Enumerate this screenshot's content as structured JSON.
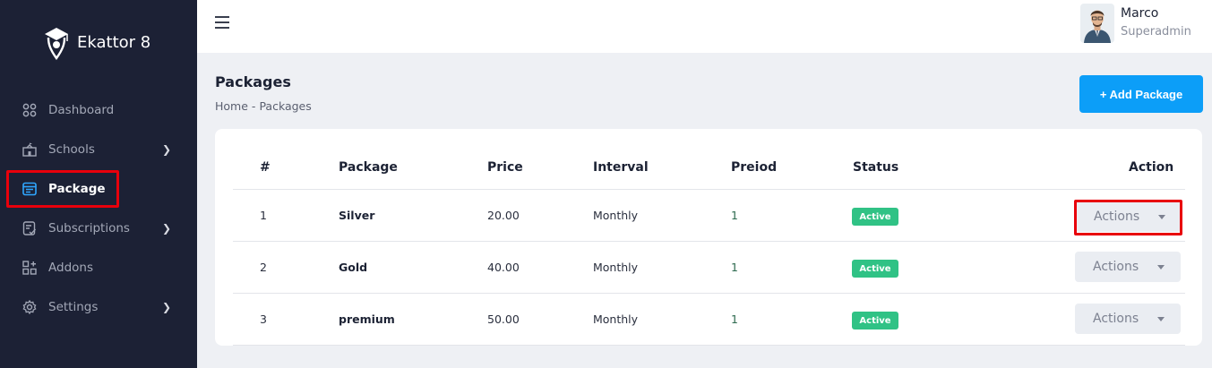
{
  "app": {
    "name": "Ekattor 8"
  },
  "sidebar": {
    "items": [
      {
        "label": "Dashboard",
        "icon": "grid-icon",
        "has_submenu": false
      },
      {
        "label": "Schools",
        "icon": "school-icon",
        "has_submenu": true
      },
      {
        "label": "Package",
        "icon": "package-icon",
        "has_submenu": false,
        "active": true
      },
      {
        "label": "Subscriptions",
        "icon": "subscription-icon",
        "has_submenu": true
      },
      {
        "label": "Addons",
        "icon": "addons-icon",
        "has_submenu": false
      },
      {
        "label": "Settings",
        "icon": "gear-icon",
        "has_submenu": true
      }
    ]
  },
  "header": {
    "user_name": "Marco",
    "user_role": "Superadmin"
  },
  "page": {
    "title": "Packages",
    "breadcrumb": [
      "Home",
      "Packages"
    ],
    "breadcrumb_sep": "-",
    "add_button": "+ Add Package"
  },
  "table": {
    "columns": [
      "#",
      "Package",
      "Price",
      "Interval",
      "Preiod",
      "Status",
      "Action"
    ],
    "rows": [
      {
        "num": "1",
        "package": "Silver",
        "price": "20.00",
        "interval": "Monthly",
        "period": "1",
        "status": "Active",
        "action": "Actions"
      },
      {
        "num": "2",
        "package": "Gold",
        "price": "40.00",
        "interval": "Monthly",
        "period": "1",
        "status": "Active",
        "action": "Actions"
      },
      {
        "num": "3",
        "package": "premium",
        "price": "50.00",
        "interval": "Monthly",
        "period": "1",
        "status": "Active",
        "action": "Actions"
      }
    ]
  },
  "colors": {
    "sidebar_bg": "#1c2135",
    "accent": "#0c9ef8",
    "status_active": "#30c285",
    "highlight": "#e8000b"
  }
}
